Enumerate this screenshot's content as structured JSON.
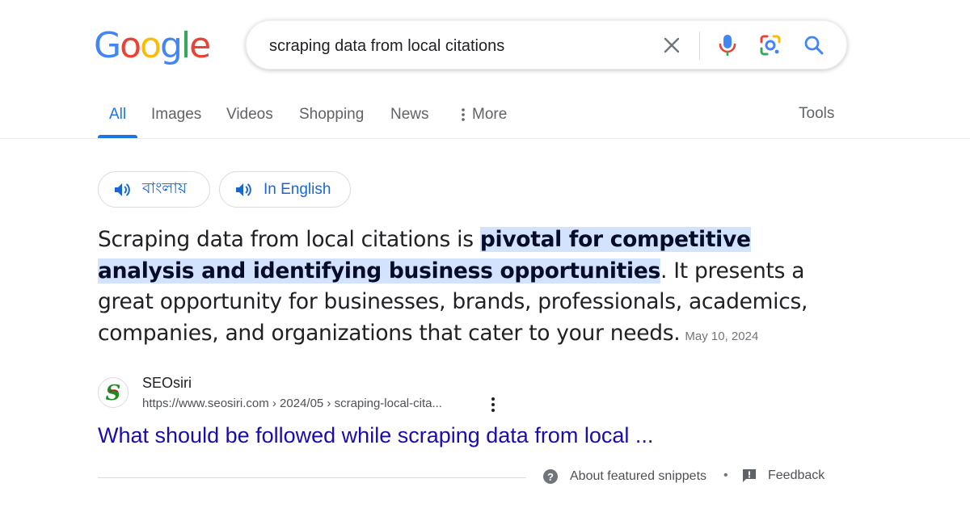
{
  "logo": {
    "letters": [
      "G",
      "o",
      "o",
      "g",
      "l",
      "e"
    ],
    "colors": [
      "#4285F4",
      "#EA4335",
      "#FBBC05",
      "#4285F4",
      "#34A853",
      "#EA4335"
    ]
  },
  "search": {
    "query": "scraping data from local citations"
  },
  "tabs": [
    {
      "label": "All",
      "active": true
    },
    {
      "label": "Images"
    },
    {
      "label": "Videos"
    },
    {
      "label": "Shopping"
    },
    {
      "label": "News"
    },
    {
      "label": "More"
    }
  ],
  "tools_label": "Tools",
  "language_chips": [
    {
      "label": "বাংলায়"
    },
    {
      "label": "In English"
    }
  ],
  "snippet": {
    "text_before": "Scraping data from local citations is ",
    "highlight": "pivotal for competitive analysis and identifying business opportunities",
    "text_after": ". It presents a great opportunity for businesses, brands, professionals, academics, companies, and organizations that cater to your needs.",
    "date": "May 10, 2024"
  },
  "source": {
    "name": "SEOsiri",
    "url": "https://www.seosiri.com › 2024/05 › scraping-local-cita...",
    "title": "What should be followed while scraping data from local ..."
  },
  "footer": {
    "about": "About featured snippets",
    "separator": "•",
    "feedback": "Feedback"
  },
  "colors": {
    "accent": "#1a73e8",
    "link": "#1a0dab",
    "highlight": "#d3e3fd"
  }
}
